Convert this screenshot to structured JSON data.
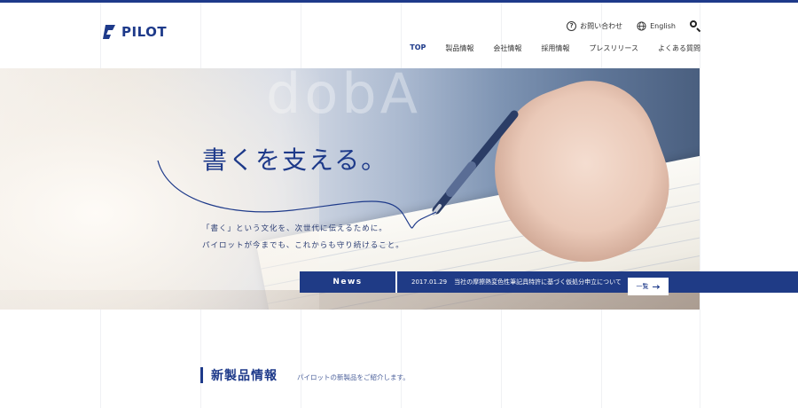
{
  "brand": {
    "name": "PILOT",
    "color": "#1e3a8a"
  },
  "utility": {
    "contact_label": "お問い合わせ",
    "contact_icon": "question-circle-icon",
    "english_label": "English",
    "english_icon": "globe-icon",
    "search_icon": "search-icon"
  },
  "nav": {
    "items": [
      {
        "label": "TOP",
        "active": true
      },
      {
        "label": "製品情報"
      },
      {
        "label": "会社情報"
      },
      {
        "label": "採用情報"
      },
      {
        "label": "プレスリリース"
      },
      {
        "label": "よくある質問"
      }
    ]
  },
  "hero": {
    "tagline": "書くを支える。",
    "desc_line1": "「書く」という文化を、次世代に伝えるために。",
    "desc_line2": "パイロットが今までも、これからも守り続けること。"
  },
  "news": {
    "label": "News",
    "date": "2017.01.29",
    "text": "当社の摩擦熱変色性筆記具特許に基づく仮処分申立について",
    "more_label": "一覧"
  },
  "section": {
    "title": "新製品情報",
    "subtitle": "パイロットの新製品をご紹介します。"
  }
}
